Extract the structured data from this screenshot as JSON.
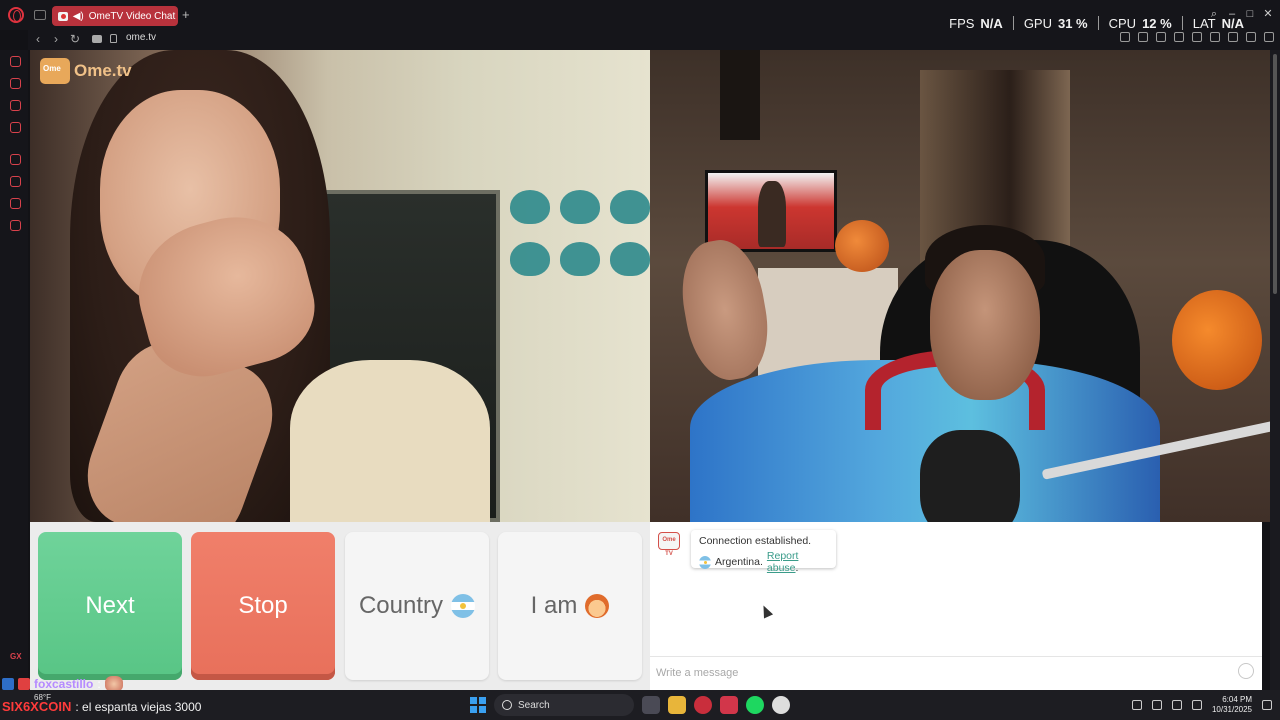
{
  "browser": {
    "tab_title": "OmeTV Video Chat -...",
    "url": "ome.tv"
  },
  "stats": [
    {
      "label": "FPS",
      "value": "N/A"
    },
    {
      "label": "GPU",
      "value": "31 %"
    },
    {
      "label": "CPU",
      "value": "12 %"
    },
    {
      "label": "LAT",
      "value": "N/A"
    }
  ],
  "sidebar": {
    "icons": [
      "refresh-icon",
      "bag-icon",
      "box-icon",
      "m-icon",
      "play-icon",
      "history-icon",
      "extensions-icon",
      "settings-icon"
    ],
    "gx_label": "GX"
  },
  "video": {
    "logo_text": "Ome.tv",
    "accent_color": "#e8a85a"
  },
  "controls": {
    "next_label": "Next",
    "stop_label": "Stop",
    "country_label": "Country",
    "iam_label": "I am"
  },
  "chat": {
    "logo_text": "Ome TV",
    "status_line1": "Connection established.",
    "status_country": "Argentina.",
    "report_link": "Report abuse",
    "report_suffix": ".",
    "placeholder": "Write a message"
  },
  "overlay": {
    "chat_user": "foxcastillo",
    "chat_colon": ":",
    "weather": "68°F",
    "message_user": "SIX6XCOIN",
    "message_text": ": el espanta viejas 3000"
  },
  "taskbar": {
    "search_label": "Search",
    "time": "6:04 PM",
    "date": "10/31/2025"
  }
}
